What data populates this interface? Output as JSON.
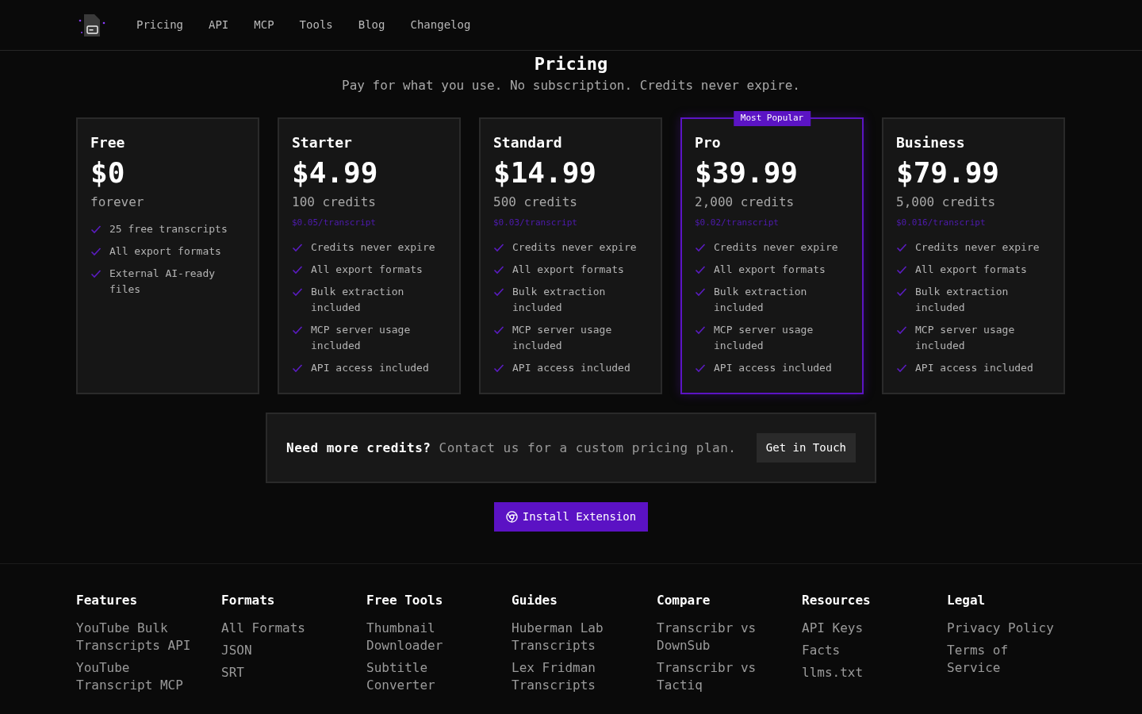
{
  "nav": {
    "links": [
      "Pricing",
      "API",
      "MCP",
      "Tools",
      "Blog",
      "Changelog"
    ]
  },
  "header": {
    "title": "Pricing",
    "subtitle": "Pay for what you use. No subscription. Credits never expire."
  },
  "plans": [
    {
      "name": "Free",
      "price": "$0",
      "amount": "forever",
      "featured": false,
      "features": [
        "25 free transcripts",
        "All export formats",
        "External AI-ready files"
      ]
    },
    {
      "name": "Starter",
      "price": "$4.99",
      "amount": "100 credits",
      "rate": "$0.05/transcript",
      "featured": false,
      "features": [
        "Credits never expire",
        "All export formats",
        "Bulk extraction included",
        "MCP server usage included",
        "API access included"
      ]
    },
    {
      "name": "Standard",
      "price": "$14.99",
      "amount": "500 credits",
      "rate": "$0.03/transcript",
      "featured": false,
      "features": [
        "Credits never expire",
        "All export formats",
        "Bulk extraction included",
        "MCP server usage included",
        "API access included"
      ]
    },
    {
      "name": "Pro",
      "price": "$39.99",
      "amount": "2,000 credits",
      "rate": "$0.02/transcript",
      "featured": true,
      "badge": "Most Popular",
      "features": [
        "Credits never expire",
        "All export formats",
        "Bulk extraction included",
        "MCP server usage included",
        "API access included"
      ]
    },
    {
      "name": "Business",
      "price": "$79.99",
      "amount": "5,000 credits",
      "rate": "$0.016/transcript",
      "featured": false,
      "features": [
        "Credits never expire",
        "All export formats",
        "Bulk extraction included",
        "MCP server usage included",
        "API access included"
      ]
    }
  ],
  "contact": {
    "text": "**Need more credits?** Contact us for a custom pricing plan.",
    "button": "Get in Touch"
  },
  "install_button": "Install Extension",
  "footer": {
    "columns": [
      {
        "heading": "Features",
        "links": [
          "YouTube Bulk Transcripts API",
          "YouTube Transcript MCP"
        ]
      },
      {
        "heading": "Formats",
        "links": [
          "All Formats",
          "JSON",
          "SRT"
        ]
      },
      {
        "heading": "Free Tools",
        "links": [
          "Thumbnail Downloader",
          "Subtitle Converter"
        ]
      },
      {
        "heading": "Guides",
        "links": [
          "Huberman Lab Transcripts",
          "Lex Fridman Transcripts"
        ]
      },
      {
        "heading": "Compare",
        "links": [
          "Transcribr vs DownSub",
          "Transcribr vs Tactiq"
        ]
      },
      {
        "heading": "Resources",
        "links": [
          "API Keys",
          "Facts",
          "llms.txt"
        ]
      },
      {
        "heading": "Legal",
        "links": [
          "Privacy Policy",
          "Terms of Service"
        ]
      }
    ]
  }
}
